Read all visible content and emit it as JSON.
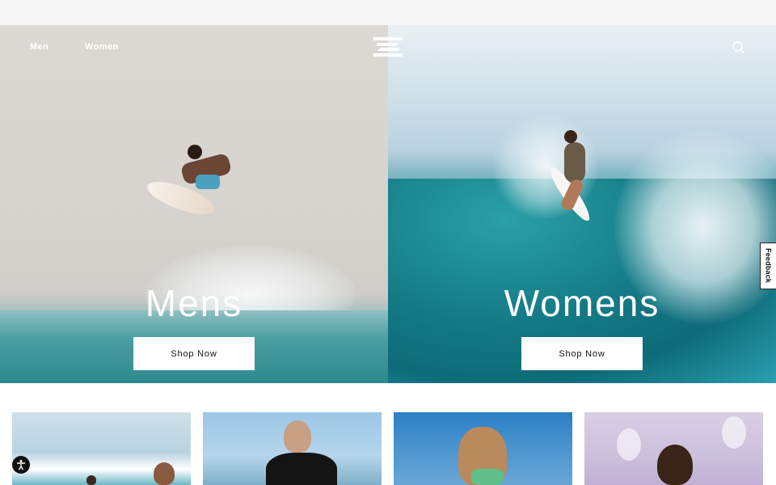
{
  "header": {
    "nav": [
      {
        "label": "Men"
      },
      {
        "label": "Women"
      }
    ],
    "logo_icon": "billabong-logo-icon",
    "search_icon": "search-icon"
  },
  "hero": {
    "men": {
      "title": "Mens",
      "cta": "Shop Now"
    },
    "women": {
      "title": "Womens",
      "cta": "Shop Now"
    }
  },
  "feedback": {
    "label": "Feedback"
  },
  "accessibility": {
    "icon": "accessibility-icon"
  },
  "colors": {
    "text_on_hero": "#ffffff",
    "button_bg": "#ffffff",
    "button_text": "#111111"
  }
}
